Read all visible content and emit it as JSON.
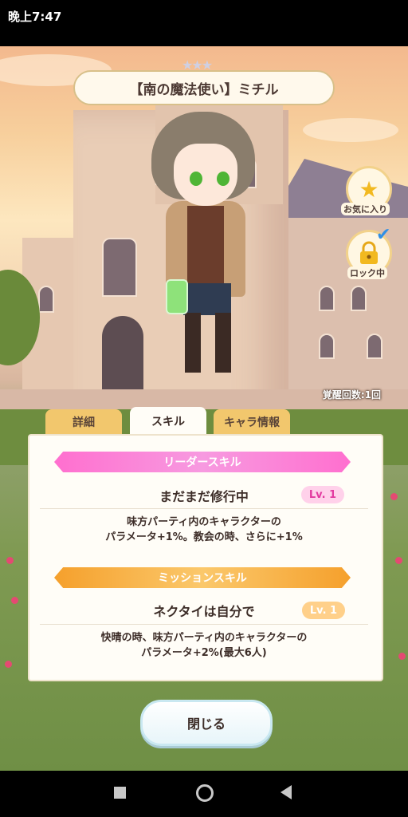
{
  "status_bar": {
    "time": "晚上7:47"
  },
  "title": {
    "stars": "★★★",
    "name": "【南の魔法使い】ミチル"
  },
  "side_buttons": {
    "favorite": {
      "icon": "star-icon",
      "label": "お気に入り"
    },
    "lock": {
      "icon": "lock-icon",
      "label": "ロック中",
      "checked": true
    }
  },
  "awaken_count": "覚醒回数:1回",
  "tabs": [
    {
      "label": "詳細",
      "active": false
    },
    {
      "label": "スキル",
      "active": true
    },
    {
      "label": "キャラ情報",
      "active": false
    }
  ],
  "leader_skill": {
    "header": "リーダースキル",
    "name": "まだまだ修行中",
    "level": "Lv. 1",
    "desc_line1": "味方パーティ内のキャラクターの",
    "desc_line2": "パラメータ+1%。教会の時、さらに+1%"
  },
  "mission_skill": {
    "header": "ミッションスキル",
    "name": "ネクタイは自分で",
    "level": "Lv. 1",
    "desc_line1": "快晴の時、味方パーティ内のキャラクターの",
    "desc_line2": "パラメータ+2%(最大6人)"
  },
  "close_button": "閉じる",
  "colors": {
    "leader": "#ff6fcf",
    "mission": "#f5a02c",
    "tab": "#f2c76d"
  }
}
